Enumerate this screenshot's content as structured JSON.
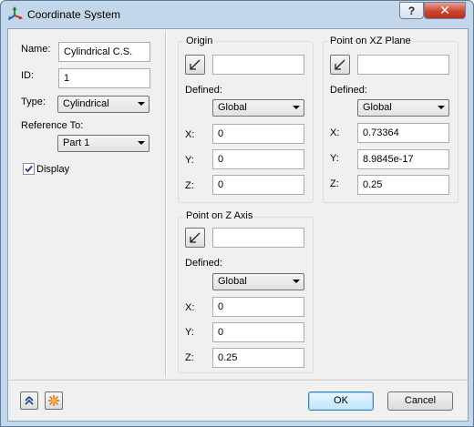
{
  "window": {
    "title": "Coordinate System"
  },
  "titlebar": {
    "help_label": "?",
    "close_label": "✕"
  },
  "left": {
    "name_label": "Name:",
    "name_value": "Cylindrical C.S.",
    "id_label": "ID:",
    "id_value": "1",
    "type_label": "Type:",
    "type_value": "Cylindrical",
    "reference_label": "Reference To:",
    "reference_value": "Part 1",
    "display_label": "Display",
    "display_checked": true
  },
  "origin": {
    "title": "Origin",
    "pick_value": "",
    "defined_label": "Defined:",
    "defined_value": "Global",
    "x_label": "X:",
    "x": "0",
    "y_label": "Y:",
    "y": "0",
    "z_label": "Z:",
    "z": "0"
  },
  "xz_plane": {
    "title": "Point on XZ Plane",
    "pick_value": "",
    "defined_label": "Defined:",
    "defined_value": "Global",
    "x_label": "X:",
    "x": "0.73364",
    "y_label": "Y:",
    "y": "8.9845e-17",
    "z_label": "Z:",
    "z": "0.25"
  },
  "z_axis": {
    "title": "Point on Z Axis",
    "pick_value": "",
    "defined_label": "Defined:",
    "defined_value": "Global",
    "x_label": "X:",
    "x": "0",
    "y_label": "Y:",
    "y": "0",
    "z_label": "Z:",
    "z": "0.25"
  },
  "footer": {
    "ok_label": "OK",
    "cancel_label": "Cancel"
  },
  "icons": {
    "app": "coordinate-axes-icon",
    "pick": "pick-point-arrow-icon",
    "collapse": "double-chevron-up-icon",
    "highlight": "highlight-burst-icon"
  },
  "colors": {
    "title_bar": "#c3d6ea",
    "close_button": "#c9452f",
    "dialog_bg": "#f0f0f0"
  }
}
